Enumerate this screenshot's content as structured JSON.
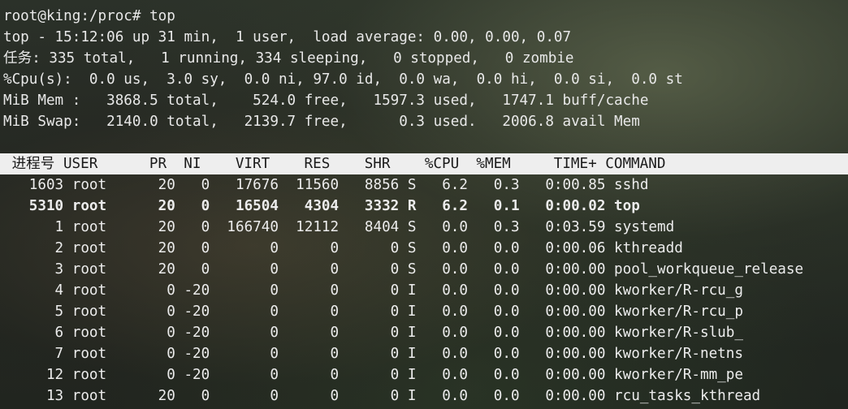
{
  "prompt": "root@king:/proc# top",
  "summary": [
    "top - 15:12:06 up 31 min,  1 user,  load average: 0.00, 0.00, 0.07",
    "任务: 335 total,   1 running, 334 sleeping,   0 stopped,   0 zombie",
    "%Cpu(s):  0.0 us,  3.0 sy,  0.0 ni, 97.0 id,  0.0 wa,  0.0 hi,  0.0 si,  0.0 st",
    "MiB Mem :   3868.5 total,    524.0 free,   1597.3 used,   1747.1 buff/cache",
    "MiB Swap:   2140.0 total,   2139.7 free,      0.3 used.   2006.8 avail Mem"
  ],
  "table_header": " 进程号 USER      PR  NI    VIRT    RES    SHR    %CPU  %MEM     TIME+ COMMAND",
  "rows": [
    "   1603 root      20   0   17676  11560   8856 S   6.2   0.3   0:00.85 sshd",
    "   5310 root      20   0   16504   4304   3332 R   6.2   0.1   0:00.02 top",
    "      1 root      20   0  166740  12112   8404 S   0.0   0.3   0:03.59 systemd",
    "      2 root      20   0       0      0      0 S   0.0   0.0   0:00.06 kthreadd",
    "      3 root      20   0       0      0      0 S   0.0   0.0   0:00.00 pool_workqueue_release",
    "      4 root       0 -20       0      0      0 I   0.0   0.0   0:00.00 kworker/R-rcu_g",
    "      5 root       0 -20       0      0      0 I   0.0   0.0   0:00.00 kworker/R-rcu_p",
    "      6 root       0 -20       0      0      0 I   0.0   0.0   0:00.00 kworker/R-slub_",
    "      7 root       0 -20       0      0      0 I   0.0   0.0   0:00.00 kworker/R-netns",
    "     12 root       0 -20       0      0      0 I   0.0   0.0   0:00.00 kworker/R-mm_pe",
    "     13 root      20   0       0      0      0 I   0.0   0.0   0:00.00 rcu_tasks_kthread"
  ]
}
